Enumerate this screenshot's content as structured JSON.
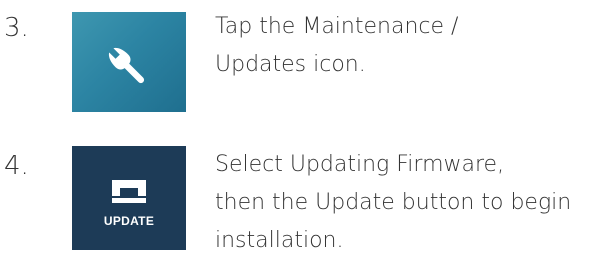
{
  "steps": [
    {
      "number": "3.",
      "icon": "wrench-icon",
      "icon_label": "",
      "tile_color": "#2c84a3",
      "lines": [
        "Tap the Maintenance /",
        "Updates icon."
      ]
    },
    {
      "number": "4.",
      "icon": "sewing-machine-icon",
      "icon_label": "UPDATE",
      "tile_color": "#1d3b57",
      "lines": [
        "Select Updating Firmware,",
        "then the Update button to begin",
        "installation."
      ]
    }
  ]
}
